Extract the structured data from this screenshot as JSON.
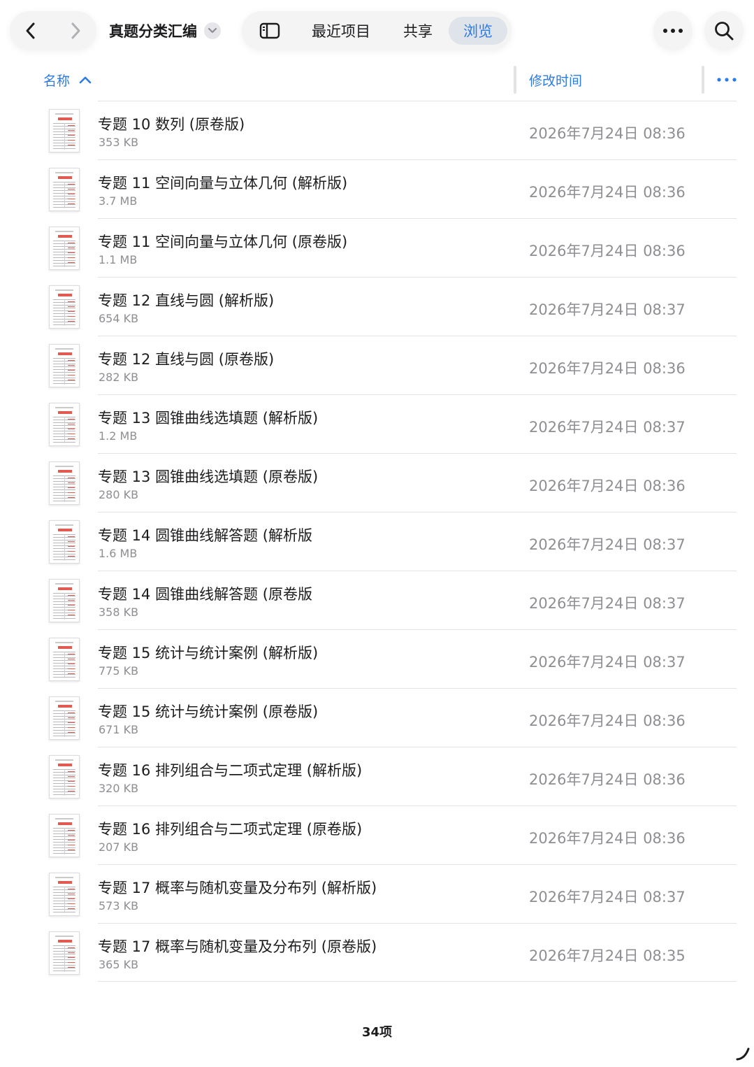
{
  "toolbar": {
    "folder_title": "真题分类汇编",
    "tabs": {
      "recent": "最近项目",
      "shared": "共享",
      "browse": "浏览"
    },
    "active_tab": "browse",
    "accent_color": "#2c7be5",
    "icons": [
      "chevron-left-icon",
      "chevron-right-icon",
      "chevron-down-icon",
      "sidebar-icon",
      "ellipsis-icon",
      "search-icon"
    ]
  },
  "columns": {
    "name": "名称",
    "modified": "修改时间",
    "sort": "ascending"
  },
  "files": [
    {
      "name": "专题 10 数列 (原卷版)",
      "size": "353 KB",
      "date": "2026年7月24日 08:36"
    },
    {
      "name": "专题 11 空间向量与立体几何 (解析版)",
      "size": "3.7 MB",
      "date": "2026年7月24日 08:36"
    },
    {
      "name": "专题 11 空间向量与立体几何 (原卷版)",
      "size": "1.1 MB",
      "date": "2026年7月24日 08:36"
    },
    {
      "name": "专题 12 直线与圆 (解析版)",
      "size": "654 KB",
      "date": "2026年7月24日 08:37"
    },
    {
      "name": "专题 12 直线与圆 (原卷版)",
      "size": "282 KB",
      "date": "2026年7月24日 08:36"
    },
    {
      "name": "专题 13 圆锥曲线选填题 (解析版)",
      "size": "1.2 MB",
      "date": "2026年7月24日 08:37"
    },
    {
      "name": "专题 13 圆锥曲线选填题 (原卷版)",
      "size": "280 KB",
      "date": "2026年7月24日 08:36"
    },
    {
      "name": "专题 14 圆锥曲线解答题 (解析版",
      "size": "1.6 MB",
      "date": "2026年7月24日 08:37"
    },
    {
      "name": "专题 14 圆锥曲线解答题 (原卷版",
      "size": "358 KB",
      "date": "2026年7月24日 08:37"
    },
    {
      "name": "专题 15 统计与统计案例 (解析版)",
      "size": "775 KB",
      "date": "2026年7月24日 08:37"
    },
    {
      "name": "专题 15 统计与统计案例 (原卷版)",
      "size": "671 KB",
      "date": "2026年7月24日 08:36"
    },
    {
      "name": "专题 16 排列组合与二项式定理 (解析版)",
      "size": "320 KB",
      "date": "2026年7月24日 08:36"
    },
    {
      "name": "专题 16 排列组合与二项式定理 (原卷版)",
      "size": "207 KB",
      "date": "2026年7月24日 08:36"
    },
    {
      "name": "专题 17 概率与随机变量及分布列 (解析版)",
      "size": "573 KB",
      "date": "2026年7月24日 08:37"
    },
    {
      "name": "专题 17 概率与随机变量及分布列 (原卷版)",
      "size": "365 KB",
      "date": "2026年7月24日 08:35"
    }
  ],
  "footer": {
    "item_count": "34项"
  }
}
